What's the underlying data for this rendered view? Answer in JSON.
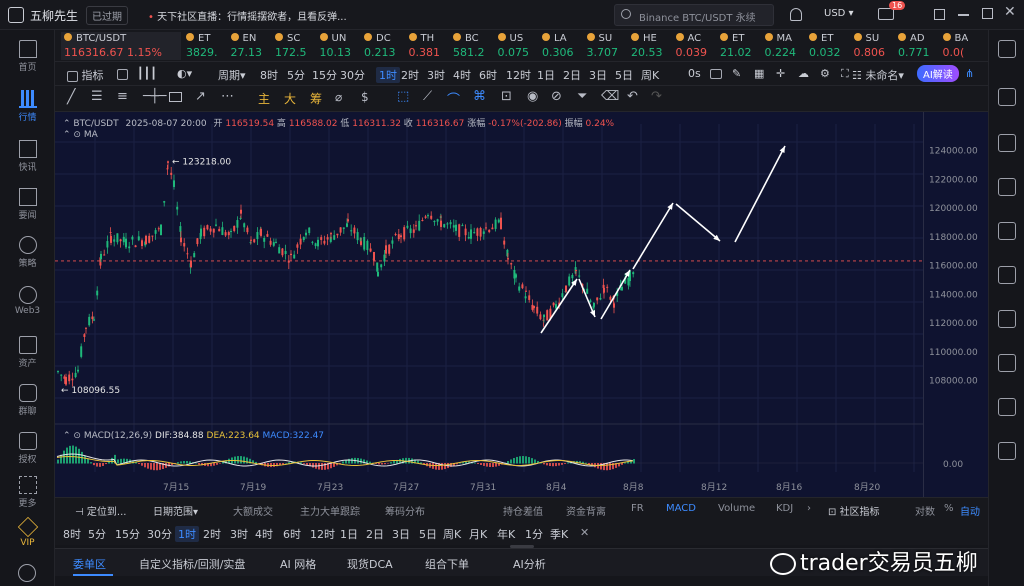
{
  "app": {
    "name": "五柳先生",
    "status_badge": "已过期",
    "news_prefix": "天下社区直播：",
    "news_text": "行情摇摆欲者，且看反弹..."
  },
  "search": {
    "placeholder": "Binance BTC/USDT 永续"
  },
  "currency": "USD",
  "mail_count": "16",
  "nav": [
    {
      "label": "首页"
    },
    {
      "label": "行情"
    },
    {
      "label": "快讯"
    },
    {
      "label": "要闻"
    },
    {
      "label": "策略"
    },
    {
      "label": "Web3"
    },
    {
      "label": "资产"
    },
    {
      "label": "群聊"
    },
    {
      "label": "授权"
    },
    {
      "label": "更多"
    },
    {
      "label": "VIP"
    }
  ],
  "tickers": [
    {
      "sym": "BTC/USDT",
      "price": "116316.67",
      "chg": "1.15%"
    },
    {
      "sym": "ET",
      "price": "3829."
    },
    {
      "sym": "EN",
      "price": "27.13"
    },
    {
      "sym": "SC",
      "price": "172.5"
    },
    {
      "sym": "UN",
      "price": "10.13"
    },
    {
      "sym": "DC",
      "price": "0.213"
    },
    {
      "sym": "TH",
      "price": "0.381"
    },
    {
      "sym": "BC",
      "price": "581.2"
    },
    {
      "sym": "US",
      "price": "0.075"
    },
    {
      "sym": "LA",
      "price": "0.306"
    },
    {
      "sym": "SU",
      "price": "3.707"
    },
    {
      "sym": "HE",
      "price": "20.53"
    },
    {
      "sym": "AC",
      "price": "0.039"
    },
    {
      "sym": "ET",
      "price": "21.02"
    },
    {
      "sym": "MA",
      "price": "0.224"
    },
    {
      "sym": "ET",
      "price": "0.032"
    },
    {
      "sym": "SU",
      "price": "0.806"
    },
    {
      "sym": "AD",
      "price": "0.771"
    },
    {
      "sym": "BA",
      "price": "0.0("
    }
  ],
  "toolbar1": {
    "indicator": "指标",
    "period": "周期",
    "intervals": [
      "8时",
      "5分",
      "15分",
      "30分",
      "1时",
      "2时",
      "3时",
      "4时",
      "6时",
      "12时",
      "1日",
      "2日",
      "3日",
      "5日",
      "周K"
    ],
    "selected": "1时",
    "os": "0s",
    "unnamed": "未命名",
    "ai": "AI解读"
  },
  "drawing": {
    "labels": [
      "主",
      "大",
      "筹"
    ]
  },
  "chart": {
    "symbol": "BTC/USDT",
    "datetime": "2025-08-07 20:00",
    "open_label": "开",
    "open": "116519.54",
    "high_label": "高",
    "high": "116588.02",
    "low_label": "低",
    "low": "116311.32",
    "close_label": "收",
    "close": "116316.67",
    "change_label": "涨幅",
    "change": "-0.17%(-202.86)",
    "amp_label": "振幅",
    "amp": "0.24%",
    "ma_label": "MA",
    "high_annot": "123218.00",
    "low_annot": "108096.55",
    "yticks": [
      "124000.00",
      "122000.00",
      "120000.00",
      "118000.00",
      "116000.00",
      "114000.00",
      "112000.00",
      "110000.00",
      "108000.00"
    ],
    "xticks": [
      "7月15",
      "7月19",
      "7月23",
      "7月27",
      "7月31",
      "8月4",
      "8月8",
      "8月12",
      "8月16",
      "8月20"
    ],
    "macd_label": "MACD(12,26,9)",
    "dif": "DIF:384.88",
    "dea": "DEA:223.64",
    "macd": "MACD:322.47",
    "macd_tick": "0.00"
  },
  "bottomtabs": [
    "定位到...",
    "日期范围",
    "大额成交",
    "主力大单跟踪",
    "筹码分布",
    "持仓差值",
    "资金背离",
    "FR",
    "MACD",
    "Volume",
    "KDJ",
    "社区指标",
    "对数",
    "%",
    "自动"
  ],
  "tf_row": [
    "8时",
    "5分",
    "15分",
    "30分",
    "1时",
    "2时",
    "3时",
    "4时",
    "6时",
    "12时",
    "1日",
    "2日",
    "3日",
    "5日",
    "周K",
    "月K",
    "年K",
    "1分",
    "季K"
  ],
  "panel_tabs": [
    "委单区",
    "自定义指标/回测/实盘",
    "AI 网格",
    "现货DCA",
    "组合下单",
    "AI分析"
  ],
  "watermark": "trader交易员五柳"
}
